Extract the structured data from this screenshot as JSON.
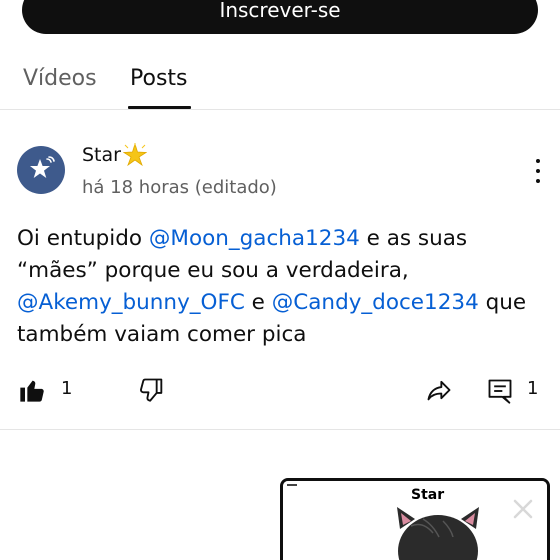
{
  "subscribe": {
    "label": "Inscrever-se"
  },
  "tabs": [
    {
      "label": "Vídeos",
      "active": false
    },
    {
      "label": "Posts",
      "active": true
    }
  ],
  "post": {
    "author": "Star",
    "author_emoji": "glowing-star",
    "time": "há 18 horas (editado)",
    "text": {
      "part1": "Oi entupido ",
      "mention1": "@Moon_gacha1234",
      "part2": "  e as suas “mães” porque eu sou a verdadeira, ",
      "mention2": "@Akemy_bunny_OFC",
      "part3": "  e ",
      "mention3": "@Candy_doce1234",
      "part4": " que também vaiam comer pica"
    },
    "like_count": "1",
    "comment_count": "1"
  },
  "mini_player": {
    "label": "Star"
  },
  "colors": {
    "mention": "#065fd4",
    "avatar_bg": "#3e5a8c",
    "subscribe_bg": "#0f0f0f"
  },
  "icons": [
    "star-icon",
    "more-vert-icon",
    "thumb-up-filled-icon",
    "thumb-down-icon",
    "share-icon",
    "comment-icon",
    "close-icon"
  ]
}
